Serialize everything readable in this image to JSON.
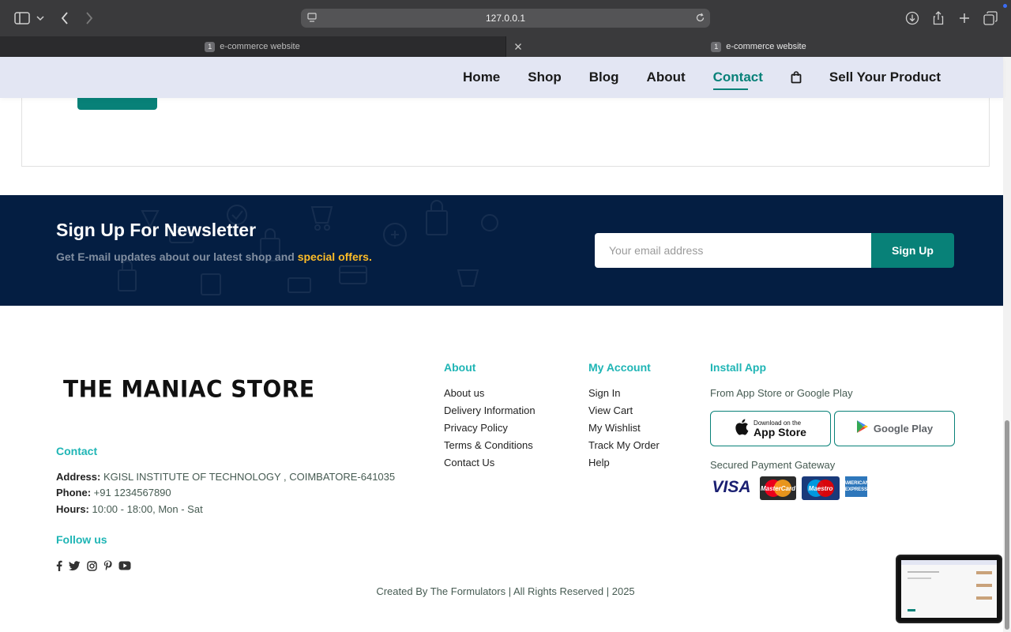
{
  "browser": {
    "url": "127.0.0.1",
    "tabs": [
      {
        "count": "1",
        "title": "e-commerce website"
      },
      {
        "count": "1",
        "title": "e-commerce website"
      }
    ]
  },
  "nav": {
    "items": [
      "Home",
      "Shop",
      "Blog",
      "About",
      "Contact",
      "Sell Your Product"
    ],
    "active": "Contact",
    "cart_icon": "shopping-bag-icon"
  },
  "newsletter": {
    "title": "Sign Up For Newsletter",
    "text_before": "Get E-mail updates about our latest shop and ",
    "text_highlight": "special offers.",
    "email_placeholder": "Your email address",
    "button_label": "Sign Up",
    "colors": {
      "background": "#041e42",
      "highlight": "#ffbd27",
      "button": "#088178"
    }
  },
  "footer": {
    "logo_text": "THE MANIAC STORE",
    "contact": {
      "heading": "Contact",
      "address_label": "Address:",
      "address_value": " KGISL INSTITUTE OF TECHNOLOGY , COIMBATORE-641035",
      "phone_label": "Phone:",
      "phone_value": " +91 1234567890",
      "hours_label": "Hours:",
      "hours_value": " 10:00 - 18:00, Mon - Sat"
    },
    "follow": {
      "heading": "Follow us",
      "icons": [
        "facebook-icon",
        "twitter-icon",
        "instagram-icon",
        "pinterest-icon",
        "youtube-icon"
      ]
    },
    "about": {
      "heading": "About",
      "links": [
        "About us",
        "Delivery Information",
        "Privacy Policy",
        "Terms & Conditions",
        "Contact Us"
      ]
    },
    "account": {
      "heading": "My Account",
      "links": [
        "Sign In",
        "View Cart",
        "My Wishlist",
        "Track My Order",
        "Help"
      ]
    },
    "install": {
      "heading": "Install App",
      "subtitle": "From App Store or Google Play",
      "appstore_small": "Download on the",
      "appstore_big": "App Store",
      "googleplay": "Google Play",
      "payment_label": "Secured Payment Gateway",
      "payments": {
        "visa": "VISA",
        "mastercard": "MasterCard",
        "maestro": "Maestro",
        "amex": "AMERICAN EXPRESS"
      }
    },
    "copyright": "Created By The Formulators | All Rights Reserved | 2025"
  }
}
